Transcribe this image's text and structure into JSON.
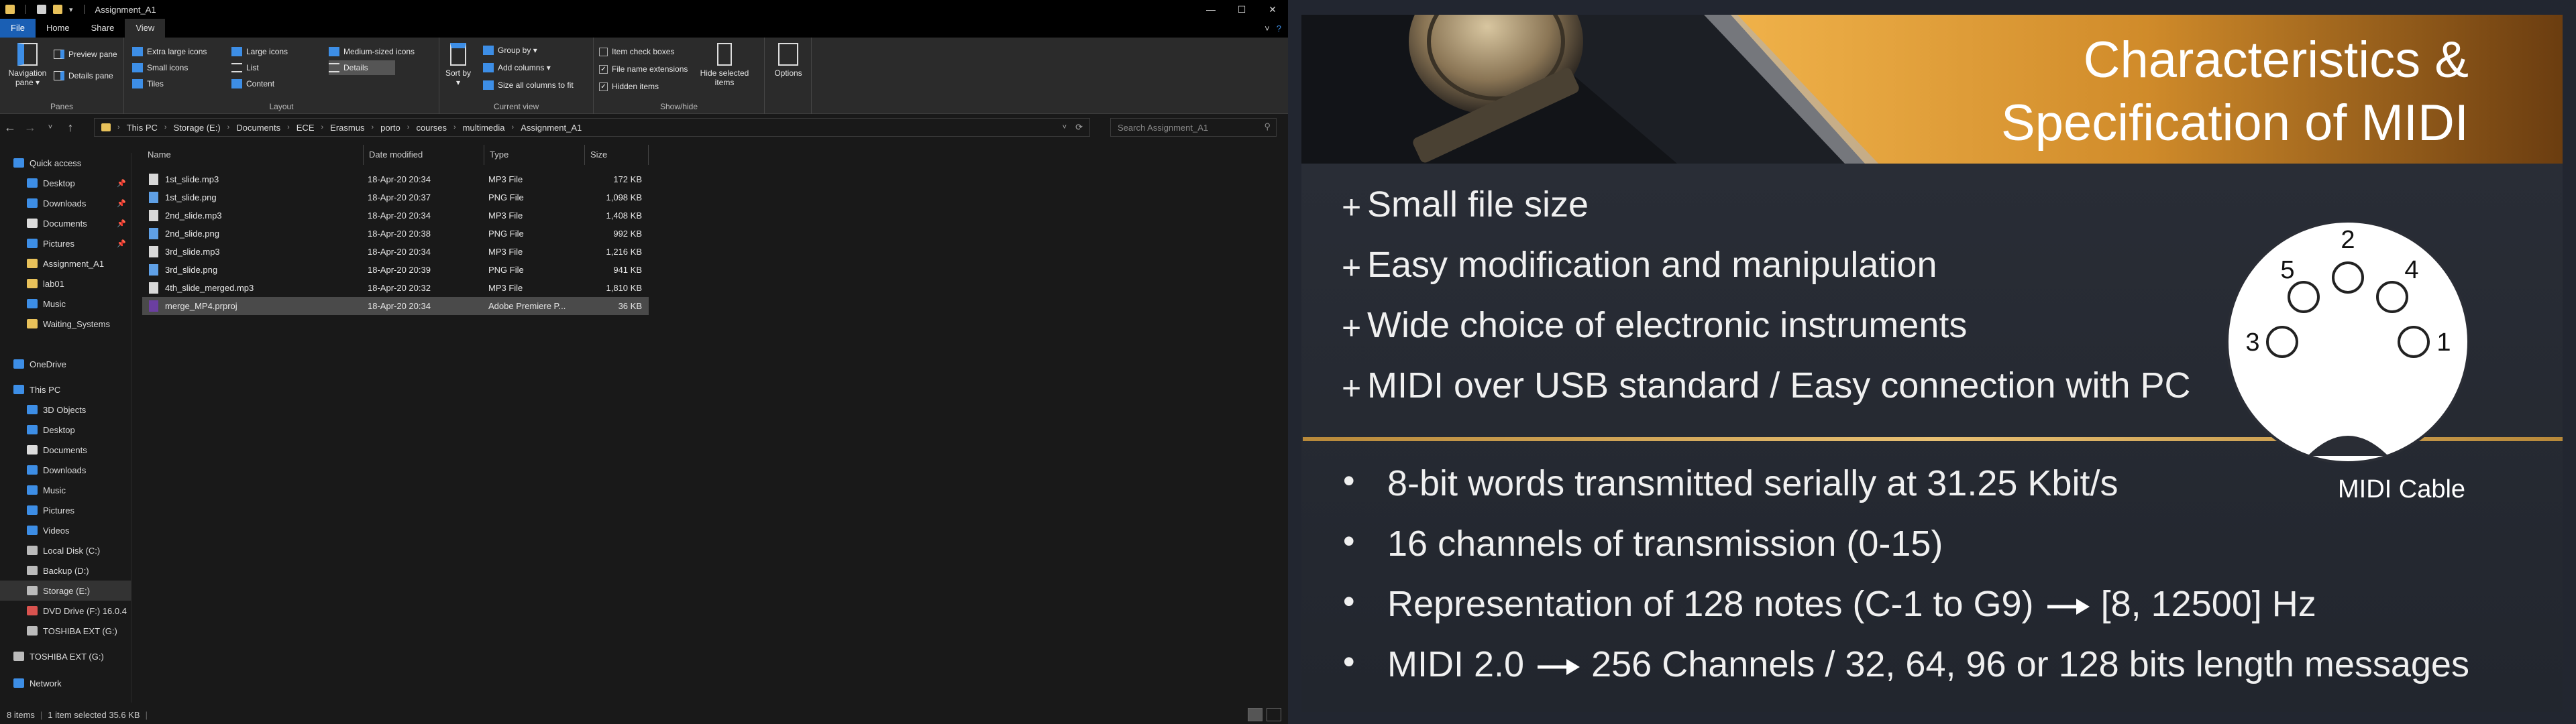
{
  "explorer": {
    "title": "Assignment_A1",
    "qa_arrow": "▾",
    "window_buttons": [
      "—",
      "☐",
      "✕"
    ],
    "tabs": [
      "File",
      "Home",
      "Share",
      "View"
    ],
    "ribbon_right": [
      "˅",
      "?"
    ],
    "ribbon": {
      "panes": {
        "navigation_pane": "Navigation pane ▾",
        "preview_pane": "Preview pane",
        "details_pane": "Details pane",
        "label": "Panes"
      },
      "layout": {
        "items": [
          "Extra large icons",
          "Large icons",
          "Medium-sized icons",
          "Small icons",
          "List",
          "Details",
          "Tiles",
          "Content"
        ],
        "label": "Layout"
      },
      "sort_by": "Sort by ▾",
      "current_view": {
        "group_by": "Group by ▾",
        "add_columns": "Add columns ▾",
        "size_all": "Size all columns to fit",
        "label": "Current view"
      },
      "show_hide": {
        "item_check_boxes": "Item check boxes",
        "file_name_extensions": "File name extensions",
        "hidden_items": "Hidden items",
        "hide_selected": "Hide selected items",
        "label": "Show/hide"
      },
      "options": "Options"
    },
    "breadcrumb": [
      "This PC",
      "Storage (E:)",
      "Documents",
      "ECE",
      "Erasmus",
      "porto",
      "courses",
      "multimedia",
      "Assignment_A1"
    ],
    "search_placeholder": "Search Assignment_A1",
    "nav": [
      {
        "label": "Quick access",
        "icon": "star-icon",
        "color": "#3d8ee6"
      },
      {
        "label": "Desktop",
        "icon": "desktop-icon",
        "color": "#3d8ee6",
        "pinned": true
      },
      {
        "label": "Downloads",
        "icon": "download-icon",
        "color": "#3d8ee6",
        "pinned": true
      },
      {
        "label": "Documents",
        "icon": "documents-icon",
        "color": "#dcdcdc",
        "pinned": true
      },
      {
        "label": "Pictures",
        "icon": "pictures-icon",
        "color": "#3d8ee6",
        "pinned": true
      },
      {
        "label": "Assignment_A1",
        "icon": "folder-icon",
        "color": "#e8c15a"
      },
      {
        "label": "lab01",
        "icon": "folder-icon",
        "color": "#e8c15a"
      },
      {
        "label": "Music",
        "icon": "music-icon",
        "color": "#3d8ee6"
      },
      {
        "label": "Waiting_Systems",
        "icon": "folder-icon",
        "color": "#e8c15a"
      },
      {
        "label": "OneDrive",
        "icon": "cloud-icon",
        "color": "#3d8ee6"
      },
      {
        "label": "This PC",
        "icon": "computer-icon",
        "color": "#3d8ee6"
      },
      {
        "label": "3D Objects",
        "icon": "cube-icon",
        "color": "#3d8ee6"
      },
      {
        "label": "Desktop",
        "icon": "desktop-icon",
        "color": "#3d8ee6"
      },
      {
        "label": "Documents",
        "icon": "documents-icon",
        "color": "#dcdcdc"
      },
      {
        "label": "Downloads",
        "icon": "download-icon",
        "color": "#3d8ee6"
      },
      {
        "label": "Music",
        "icon": "music-icon",
        "color": "#3d8ee6"
      },
      {
        "label": "Pictures",
        "icon": "pictures-icon",
        "color": "#3d8ee6"
      },
      {
        "label": "Videos",
        "icon": "video-icon",
        "color": "#3d8ee6"
      },
      {
        "label": "Local Disk (C:)",
        "icon": "drive-icon",
        "color": "#bbbbbb"
      },
      {
        "label": "Backup (D:)",
        "icon": "drive-icon",
        "color": "#bbbbbb"
      },
      {
        "label": "Storage (E:)",
        "icon": "drive-icon",
        "color": "#bbbbbb",
        "selected": true
      },
      {
        "label": "DVD Drive (F:) 16.0.4",
        "icon": "dvd-icon",
        "color": "#d9534f"
      },
      {
        "label": "TOSHIBA EXT (G:)",
        "icon": "drive-icon",
        "color": "#bbbbbb"
      },
      {
        "label": "TOSHIBA EXT (G:)",
        "icon": "drive-icon",
        "color": "#bbbbbb"
      },
      {
        "label": "Network",
        "icon": "network-icon",
        "color": "#3d8ee6"
      }
    ],
    "columns": [
      "Name",
      "Date modified",
      "Type",
      "Size"
    ],
    "files": [
      {
        "name": "1st_slide.mp3",
        "date": "18-Apr-20 20:34",
        "type": "MP3 File",
        "size": "172 KB",
        "icon": "audio-file-icon"
      },
      {
        "name": "1st_slide.png",
        "date": "18-Apr-20 20:37",
        "type": "PNG File",
        "size": "1,098 KB",
        "icon": "image-file-icon"
      },
      {
        "name": "2nd_slide.mp3",
        "date": "18-Apr-20 20:34",
        "type": "MP3 File",
        "size": "1,408 KB",
        "icon": "audio-file-icon"
      },
      {
        "name": "2nd_slide.png",
        "date": "18-Apr-20 20:38",
        "type": "PNG File",
        "size": "992 KB",
        "icon": "image-file-icon"
      },
      {
        "name": "3rd_slide.mp3",
        "date": "18-Apr-20 20:34",
        "type": "MP3 File",
        "size": "1,216 KB",
        "icon": "audio-file-icon"
      },
      {
        "name": "3rd_slide.png",
        "date": "18-Apr-20 20:39",
        "type": "PNG File",
        "size": "941 KB",
        "icon": "image-file-icon"
      },
      {
        "name": "4th_slide_merged.mp3",
        "date": "18-Apr-20 20:32",
        "type": "MP3 File",
        "size": "1,810 KB",
        "icon": "audio-file-icon"
      },
      {
        "name": "merge_MP4.prproj",
        "date": "18-Apr-20 20:34",
        "type": "Adobe Premiere P...",
        "size": "36 KB",
        "icon": "premiere-file-icon",
        "selected": true
      }
    ],
    "status": {
      "items": "8 items",
      "selected": "1 item selected  35.6 KB"
    }
  },
  "slide": {
    "title_line1": "Characteristics &",
    "title_line2": "Specification of MIDI",
    "plus_symbol": "+",
    "dot_symbol": "•",
    "plus_items": [
      "Small file size",
      "Easy modification and manipulation",
      "Wide choice of electronic instruments",
      "MIDI over USB standard / Easy connection with PC"
    ],
    "dot_items": [
      {
        "text": "8-bit words transmitted serially at 31.25 Kbit/s"
      },
      {
        "text": "16 channels of transmission (0-15)"
      },
      {
        "before": "Representation of 128 notes (C-1 to G9)",
        "after": "[8, 12500] Hz"
      },
      {
        "before": "MIDI 2.0",
        "after": "256 Channels / 32, 64, 96 or 128 bits length messages"
      }
    ],
    "connector_pins": [
      "2",
      "5",
      "4",
      "3",
      "1"
    ],
    "connector_label": "MIDI Cable",
    "colors": {
      "accent": "#c9892a",
      "text": "#ffffff",
      "background": "#262a33"
    }
  }
}
